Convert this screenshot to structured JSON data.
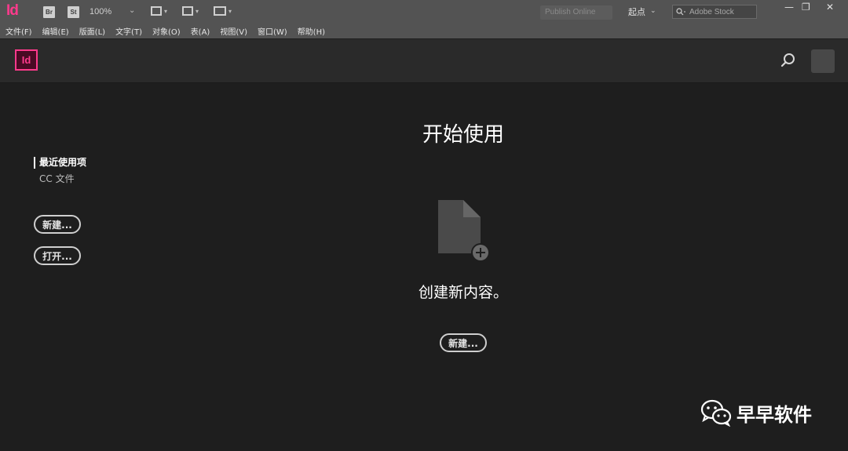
{
  "appbar": {
    "logo": "Id",
    "bridge_label": "Br",
    "stock_label": "St",
    "zoom": "100%",
    "publish_label": "Publish Online",
    "workspace": "起点",
    "stock_search_placeholder": "Adobe Stock"
  },
  "menu": {
    "items": [
      {
        "label": "文件(F)"
      },
      {
        "label": "编辑(E)"
      },
      {
        "label": "版面(L)"
      },
      {
        "label": "文字(T)"
      },
      {
        "label": "对象(O)"
      },
      {
        "label": "表(A)"
      },
      {
        "label": "视图(V)"
      },
      {
        "label": "窗口(W)"
      },
      {
        "label": "帮助(H)"
      }
    ]
  },
  "header": {
    "logo": "Id"
  },
  "nav": {
    "recent": "最近使用项",
    "cc_files": "CC 文件"
  },
  "buttons": {
    "new": "新建...",
    "open": "打开..."
  },
  "main": {
    "title": "开始使用",
    "create_text": "创建新内容。"
  },
  "watermark": {
    "text": "早早软件"
  },
  "colors": {
    "brand": "#ff3a8c",
    "background": "#1e1e1e",
    "chrome": "#535353",
    "header": "#2a2a2a"
  }
}
